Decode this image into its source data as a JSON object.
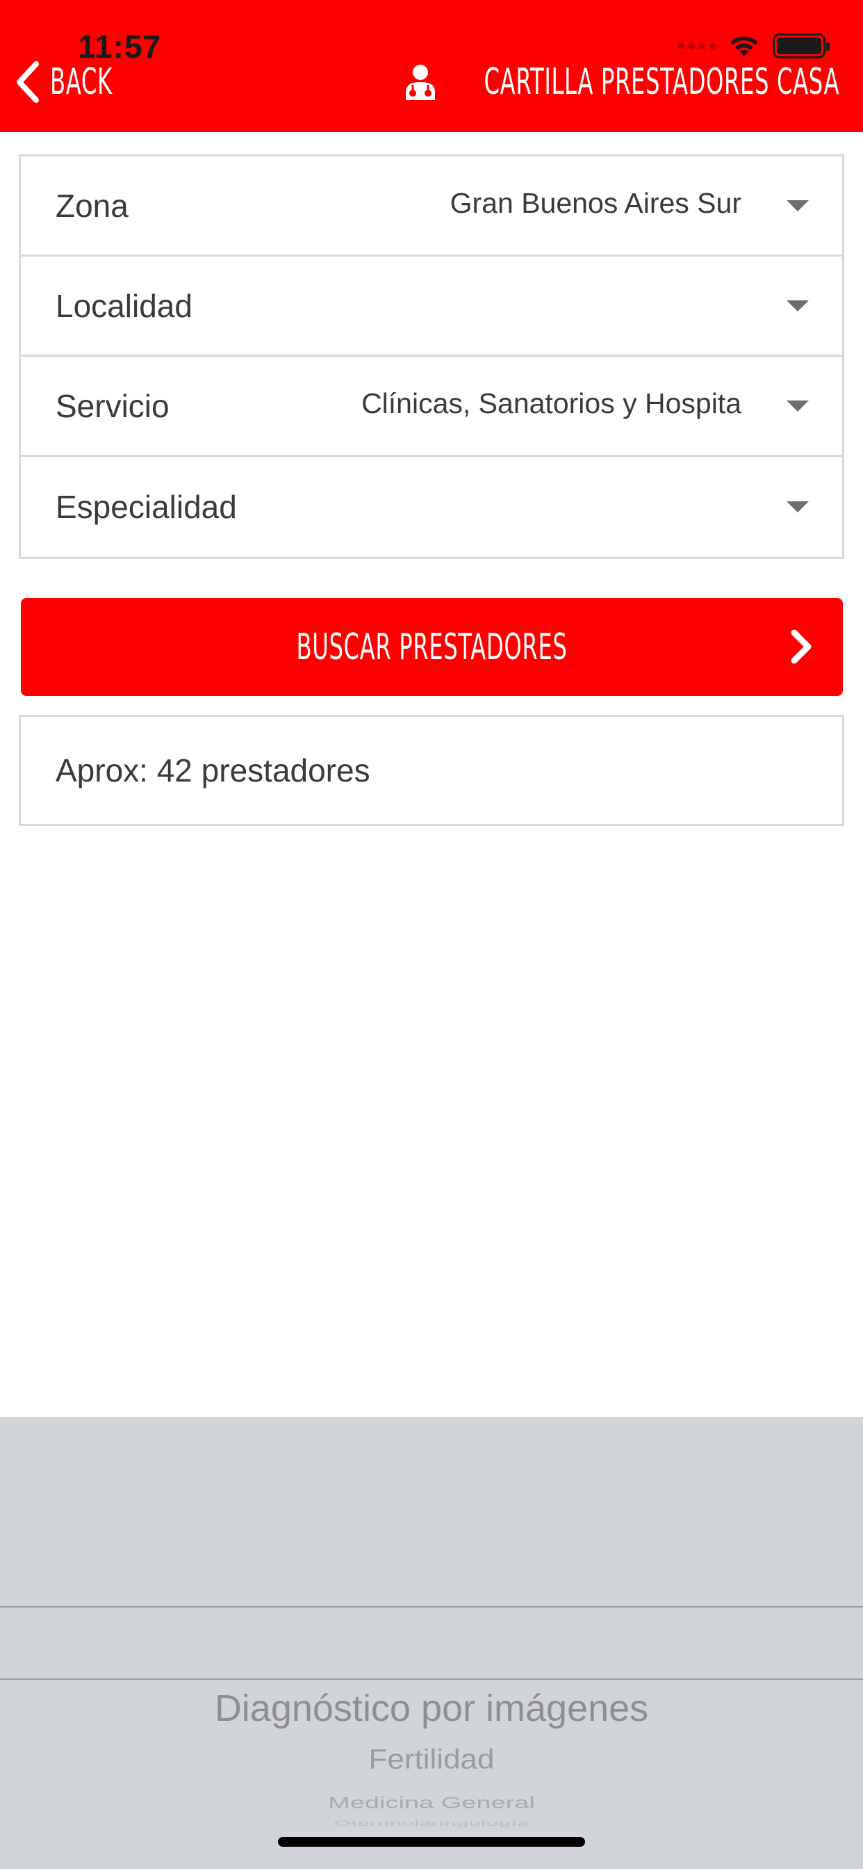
{
  "status_bar": {
    "time": "11:57",
    "signal_icon": "cellular-signal-icon",
    "wifi_icon": "wifi-icon",
    "battery_icon": "battery-icon"
  },
  "header": {
    "back_label": "BACK",
    "title": "CARTILLA PRESTADORES CASA",
    "title_icon": "doctor-icon",
    "background_color": "#ff0000"
  },
  "filters": [
    {
      "label": "Zona",
      "value": "Gran Buenos Aires Sur"
    },
    {
      "label": "Localidad",
      "value": ""
    },
    {
      "label": "Servicio",
      "value": "Clínicas, Sanatorios y Hospita"
    },
    {
      "label": "Especialidad",
      "value": ""
    }
  ],
  "search_button": {
    "label": "BUSCAR PRESTADORES",
    "icon": "chevron-right-icon"
  },
  "result_count": {
    "text": "Aprox: 42 prestadores"
  },
  "picker": {
    "items": [
      "Diagnóstico por imágenes",
      "Fertilidad",
      "Medicina General",
      "Otorrinolaringología"
    ]
  }
}
